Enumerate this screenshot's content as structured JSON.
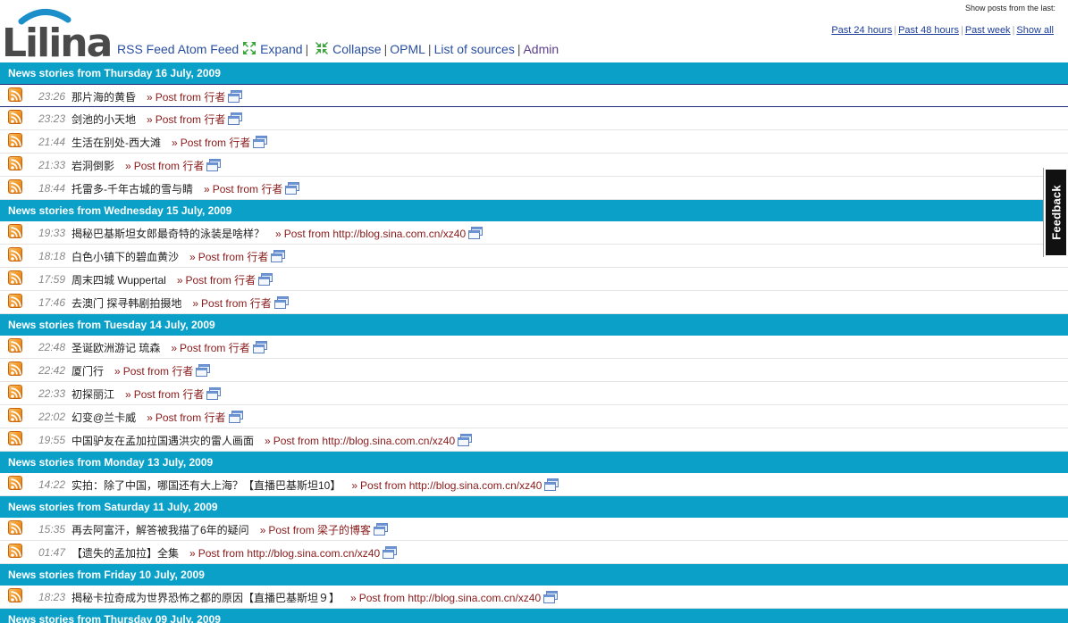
{
  "header": {
    "logo_text": "Lilina",
    "nav": [
      {
        "label": "RSS Feed",
        "name": "rss-feed-link"
      },
      {
        "label": "Atom Feed",
        "name": "atom-feed-link"
      },
      {
        "label": "Expand",
        "name": "expand-link",
        "icon": "expand-icon"
      },
      {
        "label": "Collapse",
        "name": "collapse-link",
        "icon": "collapse-icon"
      },
      {
        "label": "OPML",
        "name": "opml-link"
      },
      {
        "label": "List of sources",
        "name": "list-of-sources-link"
      },
      {
        "label": "Admin",
        "name": "admin-link"
      }
    ],
    "range_title": "Show posts from the last:",
    "range_links": [
      "Past 24 hours",
      "Past 48 hours",
      "Past week",
      "Show all"
    ]
  },
  "feedback_label": "Feedback",
  "colors": {
    "day_header_bg": "#0aa0c8",
    "source_link": "#8a1a1a",
    "nav_link": "#2a4fa0"
  },
  "days": [
    {
      "heading": "News stories from Thursday 16 July, 2009",
      "items": [
        {
          "time": "23:26",
          "title": "那片海的黄昏",
          "source": "Post from 行者"
        },
        {
          "time": "23:23",
          "title": "剑池的小天地",
          "source": "Post from 行者"
        },
        {
          "time": "21:44",
          "title": "生活在别处-西大滩",
          "source": "Post from 行者"
        },
        {
          "time": "21:33",
          "title": "岩洞倒影",
          "source": "Post from 行者"
        },
        {
          "time": "18:44",
          "title": "托雷多-千年古城的雪与睛",
          "source": "Post from 行者"
        }
      ]
    },
    {
      "heading": "News stories from Wednesday 15 July, 2009",
      "items": [
        {
          "time": "19:33",
          "title": "揭秘巴基斯坦女郎最奇特的泳装是啥样？",
          "source": "Post from http://blog.sina.com.cn/xz40"
        },
        {
          "time": "18:18",
          "title": "白色小镇下的碧血黄沙",
          "source": "Post from 行者"
        },
        {
          "time": "17:59",
          "title": "周末四城 Wuppertal",
          "source": "Post from 行者"
        },
        {
          "time": "17:46",
          "title": "去澳门 探寻韩剧拍摄地",
          "source": "Post from 行者"
        }
      ]
    },
    {
      "heading": "News stories from Tuesday 14 July, 2009",
      "items": [
        {
          "time": "22:48",
          "title": "圣诞欧洲游记 琉森",
          "source": "Post from 行者"
        },
        {
          "time": "22:42",
          "title": "厦门行",
          "source": "Post from 行者"
        },
        {
          "time": "22:33",
          "title": "初探丽江",
          "source": "Post from 行者"
        },
        {
          "time": "22:02",
          "title": "幻变@兰卡威",
          "source": "Post from 行者"
        },
        {
          "time": "19:55",
          "title": "中国驴友在孟加拉国遇洪灾的雷人画面",
          "source": "Post from http://blog.sina.com.cn/xz40"
        }
      ]
    },
    {
      "heading": "News stories from Monday 13 July, 2009",
      "items": [
        {
          "time": "14:22",
          "title": "实拍：除了中国，哪国还有大上海？【直播巴基斯坦10】",
          "source": "Post from http://blog.sina.com.cn/xz40"
        }
      ]
    },
    {
      "heading": "News stories from Saturday 11 July, 2009",
      "items": [
        {
          "time": "15:35",
          "title": "再去阿富汗，解答被我描了6年的疑问",
          "source": "Post from 梁子的博客"
        },
        {
          "time": "01:47",
          "title": "【遗失的孟加拉】全集",
          "source": "Post from http://blog.sina.com.cn/xz40"
        }
      ]
    },
    {
      "heading": "News stories from Friday 10 July, 2009",
      "items": [
        {
          "time": "18:23",
          "title": "揭秘卡拉奇成为世界恐怖之都的原因【直播巴基斯坦９】",
          "source": "Post from http://blog.sina.com.cn/xz40"
        }
      ]
    },
    {
      "heading": "News stories from Thursday 09 July, 2009",
      "items": []
    }
  ]
}
